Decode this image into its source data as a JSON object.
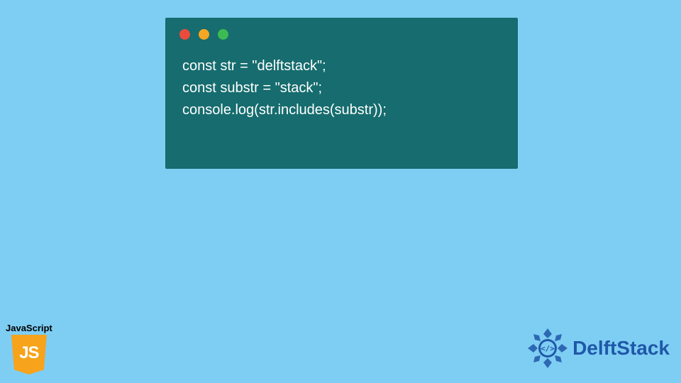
{
  "code": {
    "lines": [
      "const str = \"delftstack\";",
      "const substr = \"stack\";",
      "console.log(str.includes(substr));"
    ]
  },
  "js_badge": {
    "label": "JavaScript",
    "shield_text": "JS"
  },
  "delft_logo": {
    "text": "DelftStack"
  },
  "colors": {
    "background": "#7ecef4",
    "code_window": "#166c6e",
    "js_shield": "#f7a31b",
    "delft_blue": "#2058a8"
  }
}
